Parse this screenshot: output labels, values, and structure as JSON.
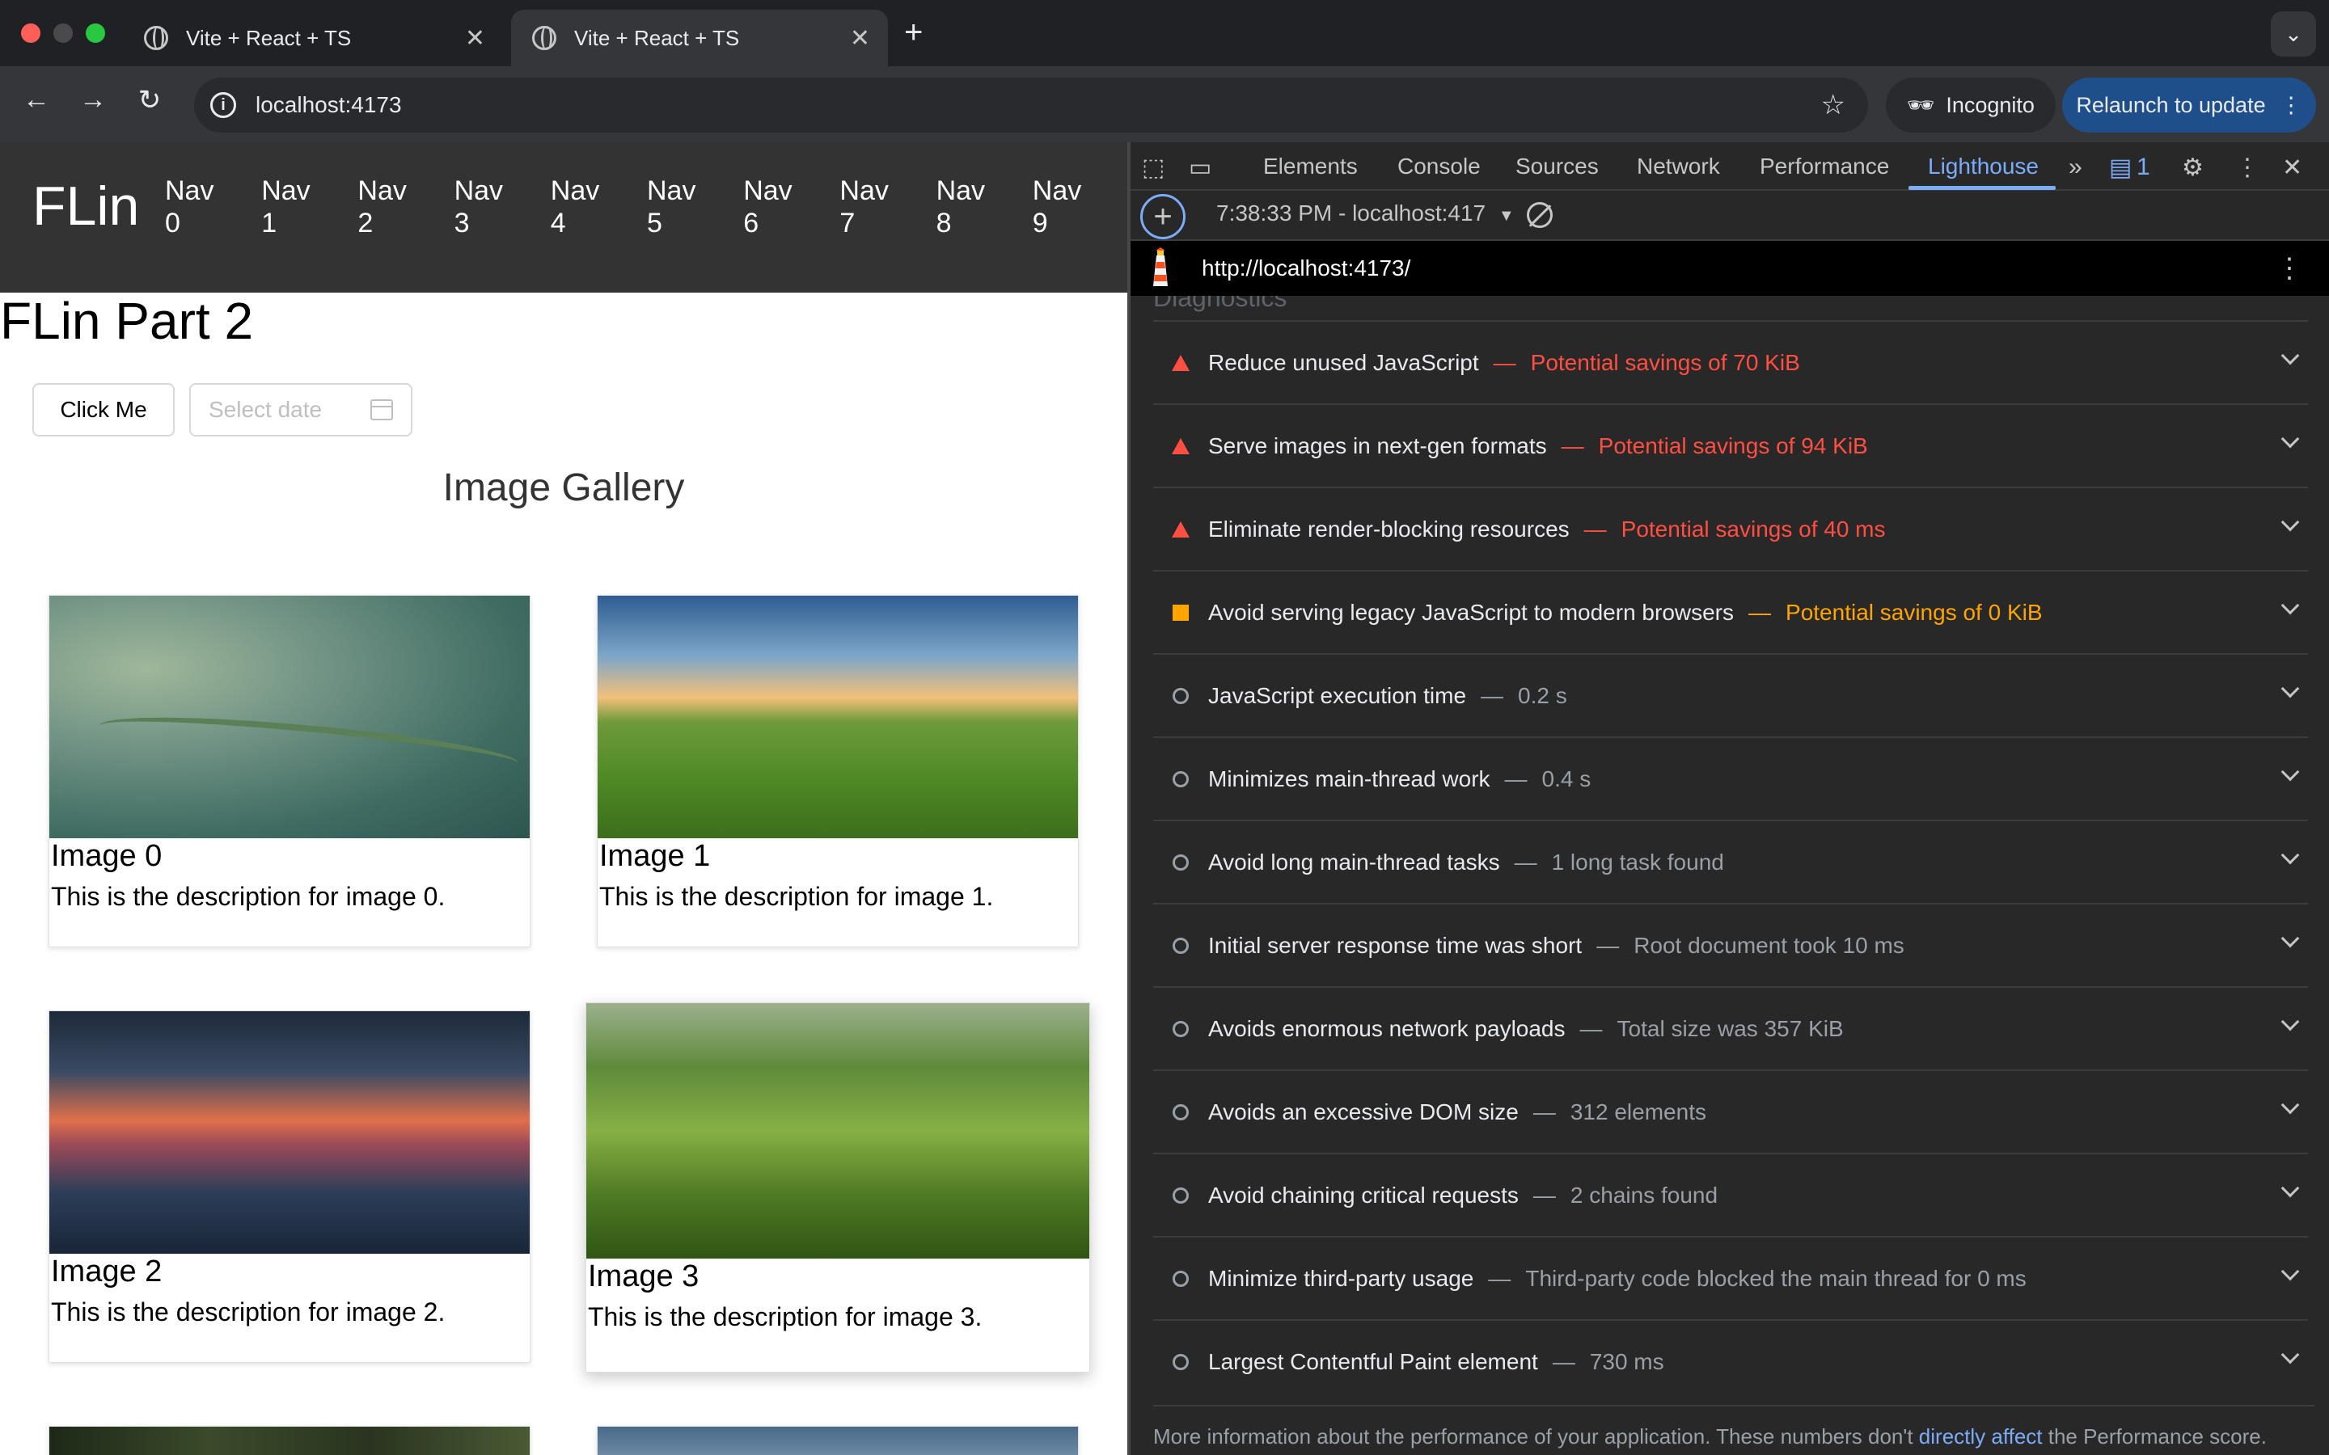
{
  "browser": {
    "tabs": [
      {
        "title": "Vite + React + TS",
        "active": false
      },
      {
        "title": "Vite + React + TS",
        "active": true
      }
    ],
    "new_tab": "+",
    "tab_search": "⌄",
    "url": "localhost:4173",
    "incognito_label": "Incognito",
    "relaunch_label": "Relaunch to update"
  },
  "page": {
    "logo": "FLin",
    "nav": [
      {
        "word": "Nav",
        "num": "0"
      },
      {
        "word": "Nav",
        "num": "1"
      },
      {
        "word": "Nav",
        "num": "2"
      },
      {
        "word": "Nav",
        "num": "3"
      },
      {
        "word": "Nav",
        "num": "4"
      },
      {
        "word": "Nav",
        "num": "5"
      },
      {
        "word": "Nav",
        "num": "6"
      },
      {
        "word": "Nav",
        "num": "7"
      },
      {
        "word": "Nav",
        "num": "8"
      },
      {
        "word": "Nav",
        "num": "9"
      }
    ],
    "heading": "FLin Part 2",
    "button_label": "Click Me",
    "date_placeholder": "Select date",
    "gallery_title": "Image Gallery",
    "cards": [
      {
        "title": "Image 0",
        "desc": "This is the description for image 0."
      },
      {
        "title": "Image 1",
        "desc": "This is the description for image 1."
      },
      {
        "title": "Image 2",
        "desc": "This is the description for image 2."
      },
      {
        "title": "Image 3",
        "desc": "This is the description for image 3."
      }
    ]
  },
  "devtools": {
    "tabs": [
      "Elements",
      "Console",
      "Sources",
      "Network",
      "Performance",
      "Lighthouse"
    ],
    "active_tab": "Lighthouse",
    "issues_count": "1",
    "report_select": "7:38:33 PM - localhost:417",
    "lh_url": "http://localhost:4173/",
    "audits_header_cut": "Diagnostics",
    "audits": [
      {
        "status": "fail",
        "title": "Reduce unused JavaScript",
        "display": "Potential savings of 70 KiB"
      },
      {
        "status": "fail",
        "title": "Serve images in next-gen formats",
        "display": "Potential savings of 94 KiB"
      },
      {
        "status": "fail",
        "title": "Eliminate render-blocking resources",
        "display": "Potential savings of 40 ms"
      },
      {
        "status": "average",
        "title": "Avoid serving legacy JavaScript to modern browsers",
        "display": "Potential savings of 0 KiB"
      },
      {
        "status": "info",
        "title": "JavaScript execution time",
        "display": "0.2 s"
      },
      {
        "status": "info",
        "title": "Minimizes main-thread work",
        "display": "0.4 s"
      },
      {
        "status": "info",
        "title": "Avoid long main-thread tasks",
        "display": "1 long task found"
      },
      {
        "status": "info",
        "title": "Initial server response time was short",
        "display": "Root document took 10 ms"
      },
      {
        "status": "info",
        "title": "Avoids enormous network payloads",
        "display": "Total size was 357 KiB"
      },
      {
        "status": "info",
        "title": "Avoids an excessive DOM size",
        "display": "312 elements"
      },
      {
        "status": "info",
        "title": "Avoid chaining critical requests",
        "display": "2 chains found"
      },
      {
        "status": "info",
        "title": "Minimize third-party usage",
        "display": "Third-party code blocked the main thread for 0 ms"
      },
      {
        "status": "info",
        "title": "Largest Contentful Paint element",
        "display": "730 ms"
      }
    ],
    "more_info_prefix": "More information about the performance of your application. These numbers don't ",
    "more_info_link": "directly affect",
    "more_info_suffix": " the Performance score."
  },
  "colors": {
    "fail": "#ff4e42",
    "average": "#ffa400",
    "accent": "#7cacf8"
  }
}
